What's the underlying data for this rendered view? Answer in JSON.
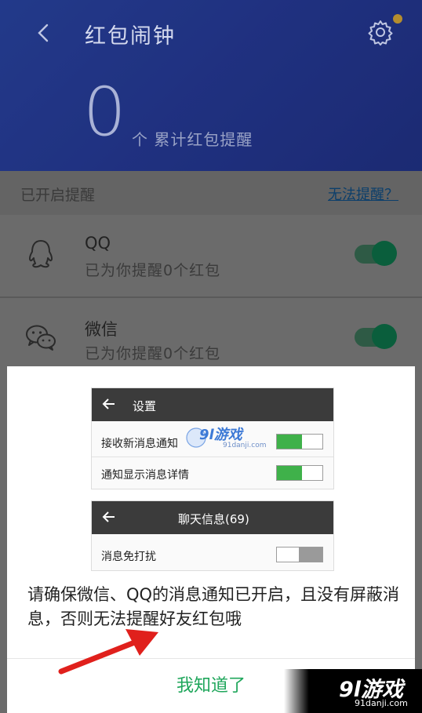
{
  "header": {
    "title": "红包闹钟",
    "count": "0",
    "count_label": "个 累计红包提醒"
  },
  "section": {
    "title": "已开启提醒",
    "help_link": "无法提醒？"
  },
  "items": [
    {
      "name": "QQ",
      "subtitle": "已为你提醒0个红包",
      "icon": "qq-icon",
      "enabled": true
    },
    {
      "name": "微信",
      "subtitle": "已为你提醒0个红包",
      "icon": "wechat-icon",
      "enabled": true
    }
  ],
  "dialog": {
    "settings_screen": {
      "title": "设置",
      "rows": [
        {
          "label": "接收新消息通知",
          "on": true
        },
        {
          "label": "通知显示消息详情",
          "on": true
        }
      ]
    },
    "chat_screen": {
      "title": "聊天信息(69)",
      "rows": [
        {
          "label": "消息免打扰",
          "on": false
        }
      ]
    },
    "message": "请确保微信、QQ的消息通知已开启，且没有屏蔽消息，否则无法提醒好友红包哦",
    "ok_label": "我知道了"
  },
  "watermark": {
    "center_text": "9l游戏",
    "center_sub": "91danji.com",
    "corner_text": "9l游戏",
    "corner_sub": "91danji.com"
  },
  "colors": {
    "header": "#263a9a",
    "toggle_on": "#0a5e3c",
    "ok_button": "#1fa65b",
    "mini_toggle_on": "#3fb14a",
    "arrow": "#e0201c"
  }
}
